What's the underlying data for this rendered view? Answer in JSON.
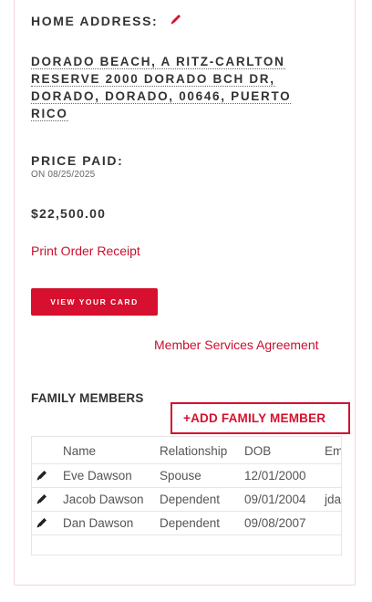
{
  "home_address": {
    "title": "HOME ADDRESS:",
    "lines": [
      "DORADO BEACH, A RITZ-CARLTON",
      "RESERVE 2000 DORADO BCH DR,",
      "DORADO, DORADO, 00646, PUERTO",
      "RICO"
    ]
  },
  "price": {
    "title": "PRICE PAID:",
    "date": "ON 08/25/2025",
    "amount": "$22,500.00"
  },
  "links": {
    "print_receipt": "Print Order Receipt",
    "view_card": "VIEW YOUR CARD",
    "member_agreement": "Member Services Agreement"
  },
  "family": {
    "title": "FAMILY MEMBERS",
    "add_button": "+ADD FAMILY MEMBER",
    "columns": [
      "Name",
      "Relationship",
      "DOB",
      "Em"
    ],
    "rows": [
      {
        "name": "Eve Dawson",
        "relationship": "Spouse",
        "dob": "12/01/2000",
        "email": ""
      },
      {
        "name": "Jacob Dawson",
        "relationship": "Dependent",
        "dob": "09/01/2004",
        "email": "jda"
      },
      {
        "name": "Dan Dawson",
        "relationship": "Dependent",
        "dob": "09/08/2007",
        "email": ""
      }
    ]
  },
  "colors": {
    "accent": "#d6102e",
    "link": "#c8102e",
    "border": "#e6e6e6",
    "card_border": "#f3d6dc"
  },
  "icons": {
    "edit_address": "pencil-icon",
    "edit_row": "pencil-icon"
  }
}
